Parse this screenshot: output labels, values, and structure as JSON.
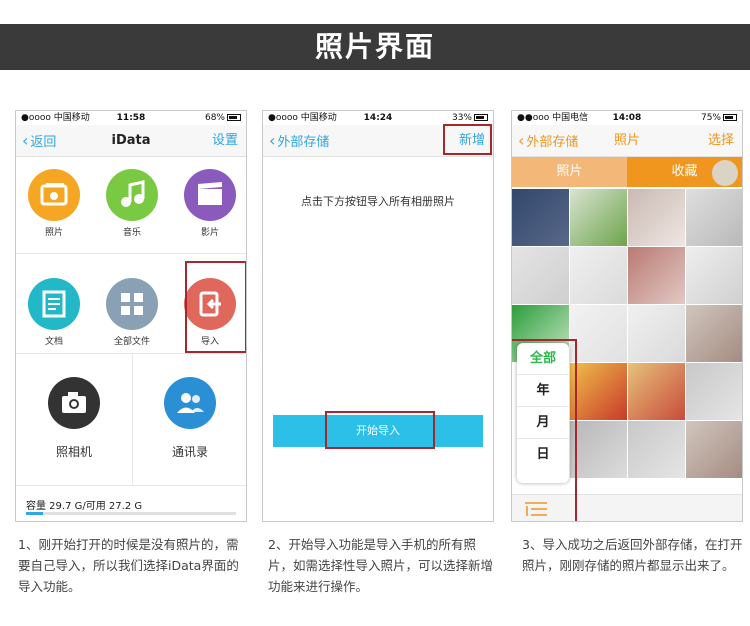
{
  "banner": {
    "title": "照片界面"
  },
  "colors": {
    "accent_blue": "#2fa7e0",
    "accent_orange": "#f0951e",
    "highlight_red": "#a5282c",
    "active_green": "#2cb84a"
  },
  "phone1": {
    "status": {
      "left": "●oooo 中国移动",
      "time": "11:58",
      "right": "68%"
    },
    "nav": {
      "back": "返回",
      "title": "iData",
      "right": "设置"
    },
    "apps": [
      {
        "label": "照片",
        "icon": "photo-icon",
        "color": "#f5a623"
      },
      {
        "label": "音乐",
        "icon": "music-icon",
        "color": "#7ac943"
      },
      {
        "label": "影片",
        "icon": "film-icon",
        "color": "#8a5bbd"
      },
      {
        "label": "文档",
        "icon": "document-icon",
        "color": "#22b8c8"
      },
      {
        "label": "全部文件",
        "icon": "all-files-icon",
        "color": "#8aa0b4"
      },
      {
        "label": "导入",
        "icon": "import-icon",
        "color": "#e0675c"
      }
    ],
    "camera": {
      "label": "照相机",
      "icon": "camera-icon",
      "color": "#333333"
    },
    "contacts": {
      "label": "通讯录",
      "icon": "contacts-icon",
      "color": "#2b8fd6"
    },
    "storage": {
      "text": "容量 29.7 G/可用 27.2 G",
      "used_fraction": 0.08
    }
  },
  "phone2": {
    "status": {
      "left": "●oooo 中国移动",
      "time": "14:24",
      "right": "33%"
    },
    "nav": {
      "back": "外部存储",
      "right": "新增"
    },
    "instruction": "点击下方按钮导入所有相册照片",
    "start_button": "开始导入"
  },
  "phone3": {
    "status": {
      "left": "●●ooo 中国电信",
      "time": "14:08",
      "right": "75%"
    },
    "nav": {
      "back": "外部存储",
      "title": "照片",
      "right": "选择"
    },
    "segments": [
      "照片",
      "收藏"
    ],
    "filters": [
      "全部",
      "年",
      "月",
      "日"
    ]
  },
  "captions": [
    "1、刚开始打开的时候是没有照片的，需要自己导入，所以我们选择iData界面的导入功能。",
    "2、开始导入功能是导入手机的所有照片，如需选择性导入照片，可以选择新增功能来进行操作。",
    "3、导入成功之后返回外部存储，在打开照片，刚刚存储的照片都显示出来了。"
  ]
}
